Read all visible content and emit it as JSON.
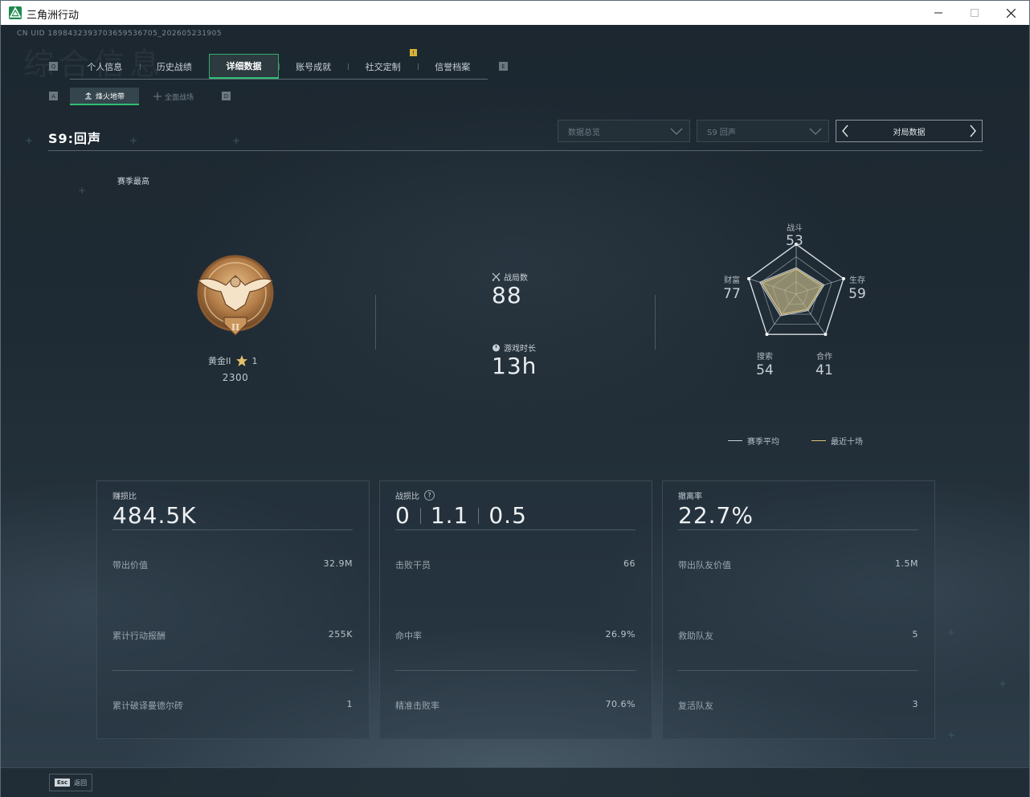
{
  "window": {
    "title": "三角洲行动"
  },
  "header": {
    "id_line": "CN UID 1898432393703659536705_202605231905",
    "watermark": "综合信息",
    "tabs": [
      {
        "label": "个人信息"
      },
      {
        "label": "历史战绩"
      },
      {
        "label": "详细数据"
      },
      {
        "label": "账号成就"
      },
      {
        "label": "社交定制"
      },
      {
        "label": "信誉档案"
      }
    ],
    "active_tab_index": 2,
    "tab_key_left": "Q",
    "tab_key_right": "E",
    "social_badge": "!",
    "subtabs": [
      {
        "label": "烽火地带"
      },
      {
        "label": "全面战场"
      }
    ],
    "subtab_key_left": "A",
    "subtab_key_right": "D"
  },
  "toolbar": {
    "season_title": "S9:回声",
    "dropdown_1": "数据总览",
    "dropdown_2": "S9 回声",
    "pager_label": "对局数据"
  },
  "rank": {
    "season_best_label": "赛季最高",
    "tier": "黄金II",
    "stars": "1",
    "score": "2300",
    "medal_roman": "II"
  },
  "summary": {
    "matches_label": "战局数",
    "matches_value": "88",
    "playtime_label": "游戏时长",
    "playtime_value": "13h"
  },
  "radar": {
    "axes": [
      {
        "label": "战斗",
        "value": "53"
      },
      {
        "label": "生存",
        "value": "59"
      },
      {
        "label": "合作",
        "value": "41"
      },
      {
        "label": "搜索",
        "value": "54"
      },
      {
        "label": "财富",
        "value": "77"
      }
    ],
    "season_avg": [
      0.53,
      0.59,
      0.41,
      0.54,
      0.77
    ],
    "recent_ten": [
      0.5,
      0.55,
      0.38,
      0.5,
      0.72
    ],
    "legend_season": "赛季平均",
    "legend_recent": "最近十场",
    "color_season": "#c9cfd3",
    "color_recent": "#d8c27a"
  },
  "cards": [
    {
      "title": "赚损比",
      "value": "484.5K",
      "rows": [
        {
          "label": "带出价值",
          "value": "32.9M"
        },
        {
          "label": "累计行动报酬",
          "value": "255K"
        },
        {
          "label": "累计破译曼德尔砖",
          "value": "1"
        }
      ]
    },
    {
      "title": "战损比",
      "values": [
        "0",
        "1.1",
        "0.5"
      ],
      "help": "?",
      "rows": [
        {
          "label": "击败干员",
          "value": "66"
        },
        {
          "label": "命中率",
          "value": "26.9%"
        },
        {
          "label": "精准击败率",
          "value": "70.6%"
        }
      ]
    },
    {
      "title": "撤离率",
      "value": "22.7%",
      "rows": [
        {
          "label": "带出队友价值",
          "value": "1.5M"
        },
        {
          "label": "救助队友",
          "value": "5"
        },
        {
          "label": "复活队友",
          "value": "3"
        }
      ]
    }
  ],
  "footer": {
    "esc_key": "Esc",
    "esc_label": "返回"
  }
}
